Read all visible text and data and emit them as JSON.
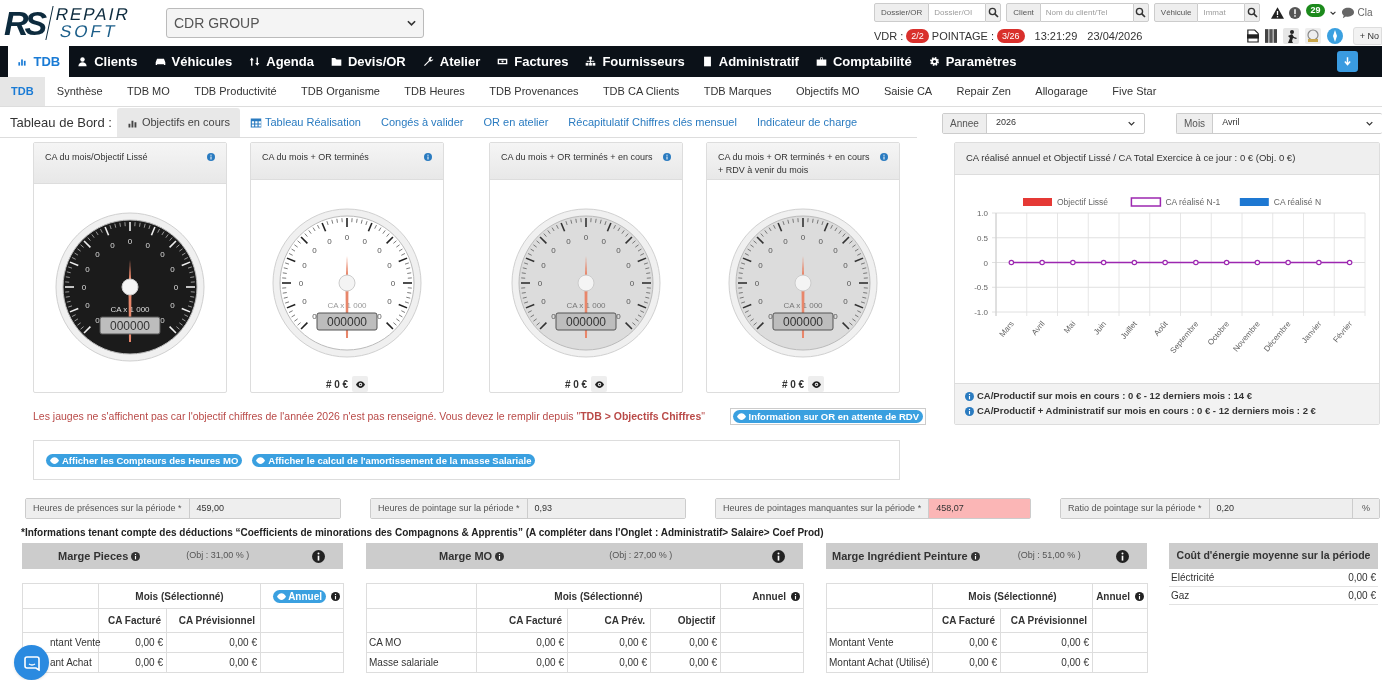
{
  "header": {
    "logo": {
      "mark": "RS",
      "line1": "REPAIR",
      "line2": "SOFT"
    },
    "company_select": "CDR GROUP",
    "searches": [
      {
        "label": "Dossier/OR",
        "placeholder": "Dossier/OI"
      },
      {
        "label": "Client",
        "placeholder": "Nom du client/Tel"
      },
      {
        "label": "Véhicule",
        "placeholder": "Immat"
      }
    ],
    "notification_count": "29",
    "user": "Cla",
    "vdr_label": "VDR :",
    "vdr": "2/2",
    "pointage_label": "POINTAGE :",
    "pointage": "3/26",
    "time": "13:21:29",
    "date": "23/04/2026",
    "new_button": "+ No"
  },
  "nav": [
    {
      "label": "TDB",
      "selected": true
    },
    {
      "label": "Clients",
      "selected": false
    },
    {
      "label": "Véhicules",
      "selected": false
    },
    {
      "label": "Agenda",
      "selected": false
    },
    {
      "label": "Devis/OR",
      "selected": false
    },
    {
      "label": "Atelier",
      "selected": false
    },
    {
      "label": "Factures",
      "selected": false
    },
    {
      "label": "Fournisseurs",
      "selected": false
    },
    {
      "label": "Administratif",
      "selected": false
    },
    {
      "label": "Comptabilité",
      "selected": false
    },
    {
      "label": "Paramètres",
      "selected": false
    }
  ],
  "sub_tabs": [
    {
      "label": "TDB",
      "selected": true
    },
    {
      "label": "Synthèse",
      "selected": false
    },
    {
      "label": "TDB MO",
      "selected": false
    },
    {
      "label": "TDB Productivité",
      "selected": false
    },
    {
      "label": "TDB Organisme",
      "selected": false
    },
    {
      "label": "TDB Heures",
      "selected": false
    },
    {
      "label": "TDB Provenances",
      "selected": false
    },
    {
      "label": "TDB CA Clients",
      "selected": false
    },
    {
      "label": "TDB Marques",
      "selected": false
    },
    {
      "label": "Objectifs MO",
      "selected": false
    },
    {
      "label": "Saisie CA",
      "selected": false
    },
    {
      "label": "Repair Zen",
      "selected": false
    },
    {
      "label": "Allogarage",
      "selected": false
    },
    {
      "label": "Five Star",
      "selected": false
    }
  ],
  "dashboard": {
    "title": "Tableau de Bord :",
    "links": [
      {
        "label": "Objectifs en cours",
        "selected": true
      },
      {
        "label": "Tableau Réalisation",
        "selected": false
      },
      {
        "label": "Congés à valider",
        "selected": false
      },
      {
        "label": "OR en atelier",
        "selected": false
      },
      {
        "label": "Récapitulatif Chiffres clés mensuel",
        "selected": false
      },
      {
        "label": "Indicateur de charge",
        "selected": false
      }
    ],
    "filters": [
      {
        "label": "Annee",
        "value": "2026"
      },
      {
        "label": "Mois",
        "value": "Avril"
      }
    ]
  },
  "gauges": [
    {
      "title": "CA du mois/Objectif Lissé",
      "kind": "dark",
      "scale": [
        "0",
        "0",
        "0",
        "0",
        "0",
        "0",
        "0",
        "0",
        "0",
        "0",
        "0",
        "0",
        "0"
      ],
      "unit": "CA x 1 000",
      "counter": "000000"
    },
    {
      "title": "CA du mois + OR terminés",
      "kind": "light",
      "scale": [
        "0",
        "0",
        "0",
        "0",
        "0",
        "0",
        "0",
        "0",
        "0",
        "0",
        "0",
        "0",
        "0"
      ],
      "unit": "CA x 1 000",
      "counter": "000000",
      "total": "# 0 €"
    },
    {
      "title": "CA du mois + OR terminés + en cours",
      "kind": "gray",
      "scale": [
        "0",
        "0",
        "0",
        "0",
        "0",
        "0",
        "0",
        "0",
        "0",
        "0",
        "0",
        "0",
        "0"
      ],
      "unit": "CA x 1 000",
      "counter": "000000",
      "total": "# 0 €"
    },
    {
      "title": "CA du mois + OR terminés + en cours + RDV à venir du mois",
      "kind": "gray",
      "scale": [
        "0",
        "0",
        "0",
        "0",
        "0",
        "0",
        "0",
        "0",
        "0",
        "0",
        "0",
        "0",
        "0"
      ],
      "unit": "CA x 1 000",
      "counter": "000000",
      "total": "# 0 €"
    }
  ],
  "warning": "Les jauges ne s'affichent pas car l'objectif chiffres de l'année 2026 n'est pas renseigné. Vous devez le remplir depuis \"**TDB > Objectifs Chiffres**\"",
  "rdv_button": "Information sur OR en attente de RDV",
  "toggle_buttons": [
    "Afficher les Compteurs des Heures MO",
    "Afficher le calcul de l'amortissement de la masse Salariale"
  ],
  "chart_panel": {
    "title": "CA réalisé annuel et Objectif Lissé / CA Total Exercice à ce jour : 0 € (Obj. 0 €)",
    "chart_data": {
      "type": "line",
      "grid": true,
      "categories": [
        "Mars",
        "Avril",
        "Mai",
        "Juin",
        "Juillet",
        "Août",
        "Septembre",
        "Octobre",
        "Novembre",
        "Décembre",
        "Janvier",
        "Février"
      ],
      "series": [
        {
          "name": "Objectif Lissé",
          "color": "#e53935",
          "values": [
            null,
            null,
            null,
            null,
            null,
            null,
            null,
            null,
            null,
            null,
            null,
            null
          ]
        },
        {
          "name": "CA réalisé N-1",
          "color": "#9c27b0",
          "marker": true,
          "values": [
            0,
            0,
            0,
            0,
            0,
            0,
            0,
            0,
            0,
            0,
            0,
            0
          ]
        },
        {
          "name": "CA réalisé N",
          "color": "#1e78d2",
          "values": [
            null,
            null,
            null,
            null,
            null,
            null,
            null,
            null,
            null,
            null,
            null,
            null
          ]
        }
      ],
      "ylim": [
        -1,
        1
      ],
      "yticks": [
        {
          "value": 1,
          "label": "1.0"
        },
        {
          "value": 0.5,
          "label": "0.5"
        },
        {
          "value": 0,
          "label": "0"
        },
        {
          "value": -0.5,
          "label": "-0.5"
        },
        {
          "value": -1,
          "label": "-1.0"
        }
      ]
    },
    "notes": [
      "CA/Productif sur mois en cours : 0 € - 12 derniers mois : 14 €",
      "CA/Productif + Administratif sur mois en cours : 0 € - 12 derniers mois : 2 €"
    ]
  },
  "fields": [
    {
      "label": "Heures de présences sur la période *",
      "value": "459,00",
      "highlighted": false
    },
    {
      "label": "Heures de pointage sur la période *",
      "value": "0,93",
      "highlighted": false
    },
    {
      "label": "Heures de pointages manquantes sur la période *",
      "value": "458,07",
      "highlighted": true
    },
    {
      "label": "Ratio de pointage sur la période *",
      "value": "0,20",
      "highlighted": false,
      "suffix": "%"
    }
  ],
  "deduction_note": "*Informations tenant compte des déductions “Coefficients de minorations des Compagnons & Apprentis” (A compléter dans l'Onglet : Administratif> Salaire> Coef Prod)",
  "margins": [
    {
      "title": "Marge Pieces",
      "objective": "(Obj : 31,00 % )",
      "group_header": "Mois (Sélectionné)",
      "annual": {
        "label": "Annuel",
        "kind": "button"
      },
      "columns": [
        "CA Facturé",
        "CA Prévisionnel"
      ],
      "rows": [
        {
          "label": "ntant Vente",
          "values": [
            "0,00 €",
            "0,00 €"
          ]
        },
        {
          "label": "ant Achat",
          "values": [
            "0,00 €",
            "0,00 €"
          ]
        }
      ]
    },
    {
      "title": "Marge MO",
      "objective": "(Obj : 27,00 % )",
      "group_header": "Mois (Sélectionné)",
      "annual": {
        "label": "Annuel",
        "kind": "text"
      },
      "columns": [
        "CA Facturé",
        "CA Prév.",
        "Objectif"
      ],
      "rows": [
        {
          "label": "CA MO",
          "values": [
            "0,00 €",
            "0,00 €",
            "0,00 €"
          ]
        },
        {
          "label": "Masse salariale",
          "values": [
            "0,00 €",
            "0,00 €",
            "0,00 €"
          ]
        }
      ]
    },
    {
      "title": "Marge Ingrédient Peinture",
      "objective": "(Obj : 51,00 % )",
      "group_header": "Mois (Sélectionné)",
      "annual": {
        "label": "Annuel",
        "kind": "text"
      },
      "columns": [
        "CA Facturé",
        "CA Prévisionnel"
      ],
      "rows": [
        {
          "label": "Montant Vente",
          "values": [
            "0,00 €",
            "0,00 €"
          ]
        },
        {
          "label": "Montant Achat (Utilisé)",
          "values": [
            "0,00 €",
            "0,00 €"
          ]
        }
      ]
    }
  ],
  "energy": {
    "title": "Coût d'énergie moyenne sur la période",
    "rows": [
      {
        "label": "Eléctricité",
        "value": "0,00 €"
      },
      {
        "label": "Gaz",
        "value": "0,00 €"
      }
    ]
  }
}
